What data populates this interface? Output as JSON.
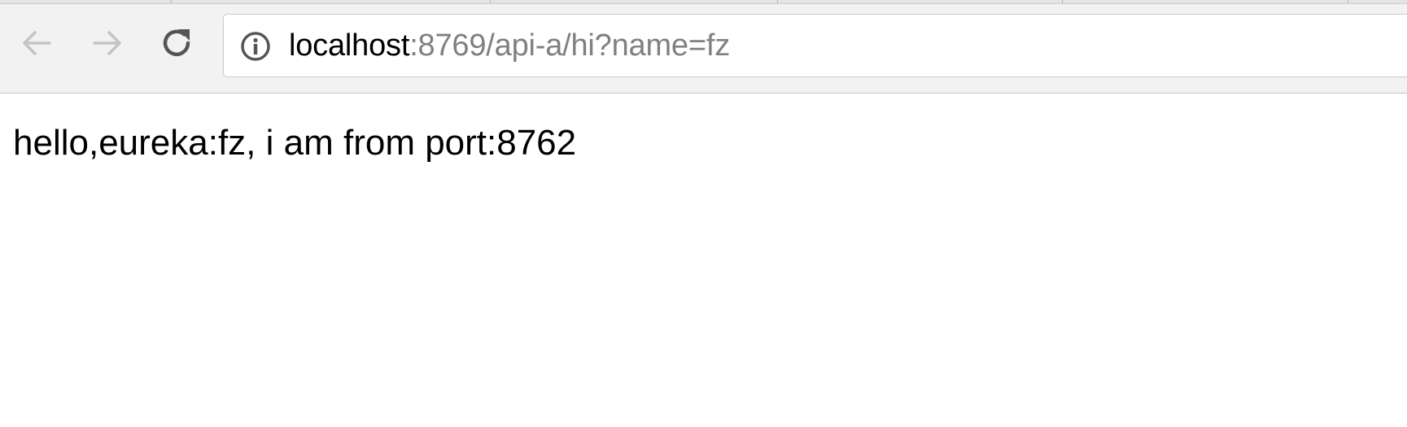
{
  "browser": {
    "address_bar": {
      "host": "localhost",
      "rest": ":8769/api-a/hi?name=fz"
    },
    "icons": {
      "back": "back-arrow-icon",
      "forward": "forward-arrow-icon",
      "reload": "reload-icon",
      "site_info": "info-icon"
    }
  },
  "page": {
    "body_text": "hello,eureka:fz, i am from port:8762"
  }
}
